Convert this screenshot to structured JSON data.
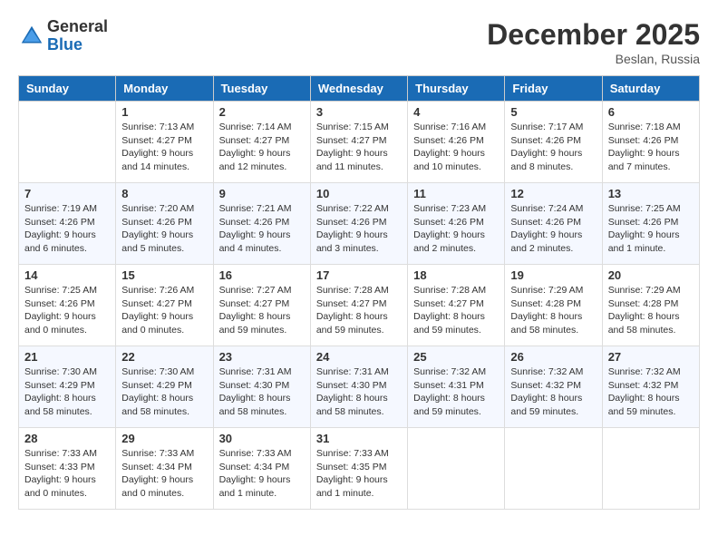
{
  "header": {
    "logo_general": "General",
    "logo_blue": "Blue",
    "month_title": "December 2025",
    "location": "Beslan, Russia"
  },
  "days_of_week": [
    "Sunday",
    "Monday",
    "Tuesday",
    "Wednesday",
    "Thursday",
    "Friday",
    "Saturday"
  ],
  "weeks": [
    [
      {
        "day": "",
        "sunrise": "",
        "sunset": "",
        "daylight": ""
      },
      {
        "day": "1",
        "sunrise": "Sunrise: 7:13 AM",
        "sunset": "Sunset: 4:27 PM",
        "daylight": "Daylight: 9 hours and 14 minutes."
      },
      {
        "day": "2",
        "sunrise": "Sunrise: 7:14 AM",
        "sunset": "Sunset: 4:27 PM",
        "daylight": "Daylight: 9 hours and 12 minutes."
      },
      {
        "day": "3",
        "sunrise": "Sunrise: 7:15 AM",
        "sunset": "Sunset: 4:27 PM",
        "daylight": "Daylight: 9 hours and 11 minutes."
      },
      {
        "day": "4",
        "sunrise": "Sunrise: 7:16 AM",
        "sunset": "Sunset: 4:26 PM",
        "daylight": "Daylight: 9 hours and 10 minutes."
      },
      {
        "day": "5",
        "sunrise": "Sunrise: 7:17 AM",
        "sunset": "Sunset: 4:26 PM",
        "daylight": "Daylight: 9 hours and 8 minutes."
      },
      {
        "day": "6",
        "sunrise": "Sunrise: 7:18 AM",
        "sunset": "Sunset: 4:26 PM",
        "daylight": "Daylight: 9 hours and 7 minutes."
      }
    ],
    [
      {
        "day": "7",
        "sunrise": "Sunrise: 7:19 AM",
        "sunset": "Sunset: 4:26 PM",
        "daylight": "Daylight: 9 hours and 6 minutes."
      },
      {
        "day": "8",
        "sunrise": "Sunrise: 7:20 AM",
        "sunset": "Sunset: 4:26 PM",
        "daylight": "Daylight: 9 hours and 5 minutes."
      },
      {
        "day": "9",
        "sunrise": "Sunrise: 7:21 AM",
        "sunset": "Sunset: 4:26 PM",
        "daylight": "Daylight: 9 hours and 4 minutes."
      },
      {
        "day": "10",
        "sunrise": "Sunrise: 7:22 AM",
        "sunset": "Sunset: 4:26 PM",
        "daylight": "Daylight: 9 hours and 3 minutes."
      },
      {
        "day": "11",
        "sunrise": "Sunrise: 7:23 AM",
        "sunset": "Sunset: 4:26 PM",
        "daylight": "Daylight: 9 hours and 2 minutes."
      },
      {
        "day": "12",
        "sunrise": "Sunrise: 7:24 AM",
        "sunset": "Sunset: 4:26 PM",
        "daylight": "Daylight: 9 hours and 2 minutes."
      },
      {
        "day": "13",
        "sunrise": "Sunrise: 7:25 AM",
        "sunset": "Sunset: 4:26 PM",
        "daylight": "Daylight: 9 hours and 1 minute."
      }
    ],
    [
      {
        "day": "14",
        "sunrise": "Sunrise: 7:25 AM",
        "sunset": "Sunset: 4:26 PM",
        "daylight": "Daylight: 9 hours and 0 minutes."
      },
      {
        "day": "15",
        "sunrise": "Sunrise: 7:26 AM",
        "sunset": "Sunset: 4:27 PM",
        "daylight": "Daylight: 9 hours and 0 minutes."
      },
      {
        "day": "16",
        "sunrise": "Sunrise: 7:27 AM",
        "sunset": "Sunset: 4:27 PM",
        "daylight": "Daylight: 8 hours and 59 minutes."
      },
      {
        "day": "17",
        "sunrise": "Sunrise: 7:28 AM",
        "sunset": "Sunset: 4:27 PM",
        "daylight": "Daylight: 8 hours and 59 minutes."
      },
      {
        "day": "18",
        "sunrise": "Sunrise: 7:28 AM",
        "sunset": "Sunset: 4:27 PM",
        "daylight": "Daylight: 8 hours and 59 minutes."
      },
      {
        "day": "19",
        "sunrise": "Sunrise: 7:29 AM",
        "sunset": "Sunset: 4:28 PM",
        "daylight": "Daylight: 8 hours and 58 minutes."
      },
      {
        "day": "20",
        "sunrise": "Sunrise: 7:29 AM",
        "sunset": "Sunset: 4:28 PM",
        "daylight": "Daylight: 8 hours and 58 minutes."
      }
    ],
    [
      {
        "day": "21",
        "sunrise": "Sunrise: 7:30 AM",
        "sunset": "Sunset: 4:29 PM",
        "daylight": "Daylight: 8 hours and 58 minutes."
      },
      {
        "day": "22",
        "sunrise": "Sunrise: 7:30 AM",
        "sunset": "Sunset: 4:29 PM",
        "daylight": "Daylight: 8 hours and 58 minutes."
      },
      {
        "day": "23",
        "sunrise": "Sunrise: 7:31 AM",
        "sunset": "Sunset: 4:30 PM",
        "daylight": "Daylight: 8 hours and 58 minutes."
      },
      {
        "day": "24",
        "sunrise": "Sunrise: 7:31 AM",
        "sunset": "Sunset: 4:30 PM",
        "daylight": "Daylight: 8 hours and 58 minutes."
      },
      {
        "day": "25",
        "sunrise": "Sunrise: 7:32 AM",
        "sunset": "Sunset: 4:31 PM",
        "daylight": "Daylight: 8 hours and 59 minutes."
      },
      {
        "day": "26",
        "sunrise": "Sunrise: 7:32 AM",
        "sunset": "Sunset: 4:32 PM",
        "daylight": "Daylight: 8 hours and 59 minutes."
      },
      {
        "day": "27",
        "sunrise": "Sunrise: 7:32 AM",
        "sunset": "Sunset: 4:32 PM",
        "daylight": "Daylight: 8 hours and 59 minutes."
      }
    ],
    [
      {
        "day": "28",
        "sunrise": "Sunrise: 7:33 AM",
        "sunset": "Sunset: 4:33 PM",
        "daylight": "Daylight: 9 hours and 0 minutes."
      },
      {
        "day": "29",
        "sunrise": "Sunrise: 7:33 AM",
        "sunset": "Sunset: 4:34 PM",
        "daylight": "Daylight: 9 hours and 0 minutes."
      },
      {
        "day": "30",
        "sunrise": "Sunrise: 7:33 AM",
        "sunset": "Sunset: 4:34 PM",
        "daylight": "Daylight: 9 hours and 1 minute."
      },
      {
        "day": "31",
        "sunrise": "Sunrise: 7:33 AM",
        "sunset": "Sunset: 4:35 PM",
        "daylight": "Daylight: 9 hours and 1 minute."
      },
      {
        "day": "",
        "sunrise": "",
        "sunset": "",
        "daylight": ""
      },
      {
        "day": "",
        "sunrise": "",
        "sunset": "",
        "daylight": ""
      },
      {
        "day": "",
        "sunrise": "",
        "sunset": "",
        "daylight": ""
      }
    ]
  ]
}
